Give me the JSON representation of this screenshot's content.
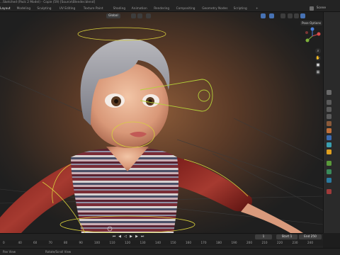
{
  "window": {
    "title": "...Sketched (Pack 2 Model) - Copie (59) [Source\\Blender.blend]",
    "scene_label": "Scene"
  },
  "workspace_tabs": [
    {
      "label": "Layout",
      "active": true
    },
    {
      "label": "Modeling",
      "active": false
    },
    {
      "label": "Sculpting",
      "active": false
    },
    {
      "label": "UV Editing",
      "active": false
    },
    {
      "label": "Texture Paint",
      "active": false
    },
    {
      "label": "Shading",
      "active": false
    },
    {
      "label": "Animation",
      "active": false
    },
    {
      "label": "Rendering",
      "active": false
    },
    {
      "label": "Compositing",
      "active": false
    },
    {
      "label": "Geometry Nodes",
      "active": false
    },
    {
      "label": "Scripting",
      "active": false
    },
    {
      "label": "+",
      "active": false
    }
  ],
  "viewport": {
    "mode_label": "Global",
    "pose_options_label": "Pose Options",
    "nav_buttons": [
      "zoom-icon",
      "hand-icon",
      "camera-icon",
      "grid-icon"
    ]
  },
  "timeline": {
    "current_frame": "1",
    "start_label": "Start",
    "start_value": "1",
    "end_label": "End",
    "end_value": "250",
    "ruler_ticks": [
      "0",
      "40",
      "60",
      "70",
      "80",
      "90",
      "100",
      "110",
      "120",
      "130",
      "140",
      "150",
      "160",
      "170",
      "180",
      "190",
      "200",
      "210",
      "220",
      "230",
      "240"
    ]
  },
  "status_bar": {
    "left_item": "Pan View",
    "mid_item": "Rotate/Scroll View",
    "right_item": ""
  },
  "colors": {
    "accent_blue": "#4772b3",
    "bone_yellow": "#d8d03c",
    "bone_green": "#b5d13a"
  }
}
